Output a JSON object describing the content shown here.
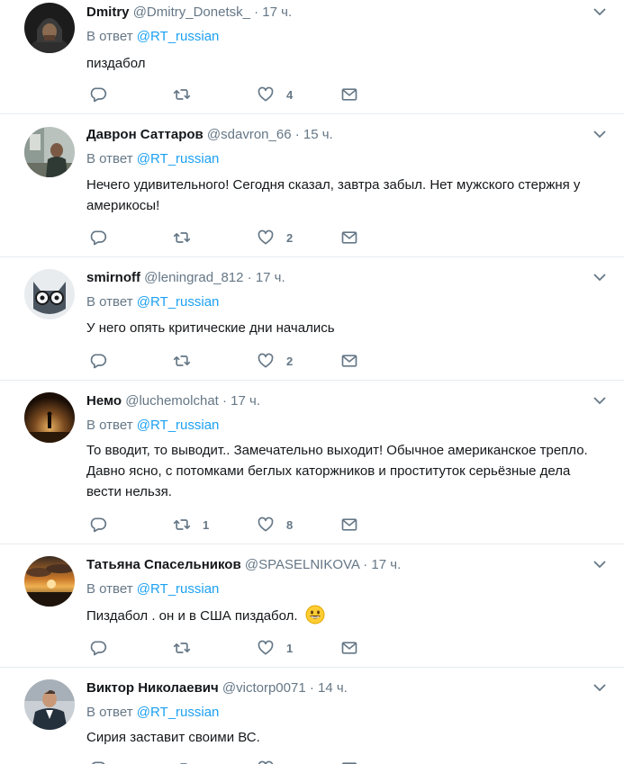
{
  "reply_prefix": "В ответ",
  "tweets": [
    {
      "name": "Dmitry",
      "handle": "@Dmitry_Donetsk_",
      "time": "17 ч.",
      "mention": "@RT_russian",
      "text": "пиздабол",
      "replies": "",
      "retweets": "",
      "likes": "4",
      "avatar_icon": "avatar-hooded-figure"
    },
    {
      "name": "Даврон Саттаров",
      "handle": "@sdavron_66",
      "time": "15 ч.",
      "mention": "@RT_russian",
      "text": "Нечего удивительного! Сегодня сказал, завтра забыл. Нет мужского стержня у америкосы!",
      "replies": "",
      "retweets": "",
      "likes": "2",
      "avatar_icon": "avatar-man-at-desk"
    },
    {
      "name": "smirnoff",
      "handle": "@leningrad_812",
      "time": "17 ч.",
      "mention": "@RT_russian",
      "text": "У него опять критические дни начались",
      "replies": "",
      "retweets": "",
      "likes": "2",
      "avatar_icon": "avatar-cat-with-glasses"
    },
    {
      "name": "Немо",
      "handle": "@luchemolchat",
      "time": "17 ч.",
      "mention": "@RT_russian",
      "text": "То вводит, то выводит.. Замечательно выходит! Обычное американское трепло. Давно ясно, с потомками беглых каторжников и проституток серьёзные дела вести нельзя.",
      "replies": "",
      "retweets": "1",
      "likes": "8",
      "avatar_icon": "avatar-silhouette-sunset"
    },
    {
      "name": "Татьяна Спасельников",
      "handle": "@SPASELNIKOVA",
      "time": "17 ч.",
      "mention": "@RT_russian",
      "text": "Пиздабол . он и в США пиздабол.",
      "text_emoji": "grinning-face-emoji",
      "replies": "",
      "retweets": "",
      "likes": "1",
      "avatar_icon": "avatar-sunset-clouds"
    },
    {
      "name": "Виктор Николаевич",
      "handle": "@victorp0071",
      "time": "14 ч.",
      "mention": "@RT_russian",
      "text": "Сирия заставит своими ВС.",
      "replies": "",
      "retweets": "",
      "likes": "",
      "avatar_icon": "avatar-man-in-suit"
    }
  ],
  "colors": {
    "text": "#14171a",
    "muted": "#657786",
    "link": "#1da1f2",
    "divider": "#e6ecf0"
  }
}
